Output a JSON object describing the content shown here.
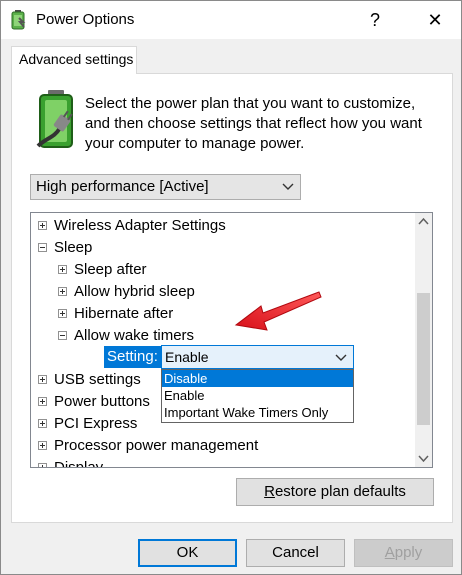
{
  "window": {
    "title": "Power Options",
    "help": "?",
    "close": "✕"
  },
  "tab": {
    "label": "Advanced settings"
  },
  "description": {
    "line1": "Select the power plan that you want to customize,",
    "line2": "and then choose settings that reflect how you want",
    "line3": "your computer to manage power."
  },
  "plan_select": {
    "value": "High performance [Active]"
  },
  "tree": {
    "items": [
      {
        "label": "Wireless Adapter Settings",
        "expander": "plus"
      },
      {
        "label": "Sleep",
        "expander": "minus"
      },
      {
        "label": "Sleep after",
        "expander": "plus"
      },
      {
        "label": "Allow hybrid sleep",
        "expander": "plus"
      },
      {
        "label": "Hibernate after",
        "expander": "plus"
      },
      {
        "label": "Allow wake timers",
        "expander": "minus"
      },
      {
        "label": "USB settings",
        "expander": "plus"
      },
      {
        "label": "Power buttons",
        "expander": "plus"
      },
      {
        "label": "PCI Express",
        "expander": "plus"
      },
      {
        "label": "Processor power management",
        "expander": "plus"
      },
      {
        "label": "Display",
        "expander": "plus"
      }
    ]
  },
  "setting": {
    "label": "Setting:",
    "value": "Enable",
    "options": [
      "Disable",
      "Enable",
      "Important Wake Timers Only"
    ],
    "highlighted": "Disable"
  },
  "buttons": {
    "restore_prefix": "R",
    "restore_rest": "estore plan defaults",
    "ok": "OK",
    "cancel": "Cancel",
    "apply_prefix": "A",
    "apply_rest": "pply"
  },
  "colors": {
    "accent": "#0078d7",
    "arrow": "#e8141c",
    "battery": "#3aa02f"
  }
}
